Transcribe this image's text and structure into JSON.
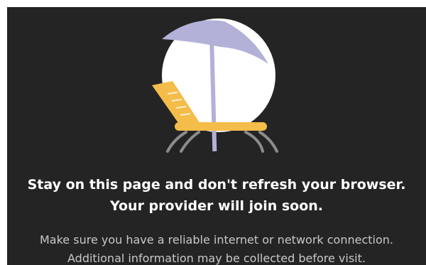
{
  "waiting_room": {
    "illustration_icon": "beach-lounge-chair-umbrella-icon",
    "heading_line1": "Stay on this page and don't refresh your browser.",
    "heading_line2": "Your provider will join soon.",
    "body_line1": "Make sure you have a reliable internet or network connection.",
    "body_line2": "Additional information may be collected before visit."
  },
  "colors": {
    "background": "#242424",
    "circle": "#ffffff",
    "umbrella": "#b3b1d8",
    "chair": "#f4bd49",
    "legs": "#8c8c8c",
    "heading_text": "#ffffff",
    "body_text": "#c8c8c8"
  }
}
